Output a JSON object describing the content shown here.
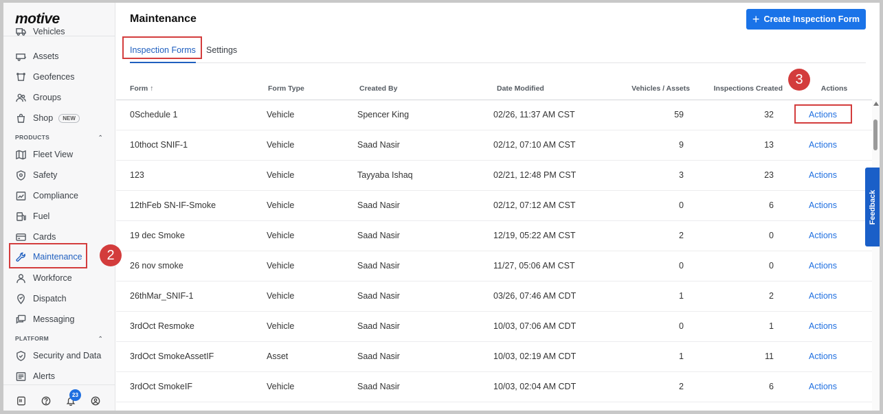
{
  "brand": {
    "logo": "motive"
  },
  "sidebar": {
    "items_top": [
      {
        "label": "Vehicles",
        "icon": "truck-icon"
      },
      {
        "label": "Assets",
        "icon": "trailer-icon"
      },
      {
        "label": "Geofences",
        "icon": "geofence-icon"
      },
      {
        "label": "Groups",
        "icon": "groups-icon"
      },
      {
        "label": "Shop",
        "icon": "shop-icon",
        "badge": "NEW"
      }
    ],
    "products_header": "PRODUCTS",
    "products": [
      {
        "label": "Fleet View",
        "icon": "map-icon"
      },
      {
        "label": "Safety",
        "icon": "shield-icon"
      },
      {
        "label": "Compliance",
        "icon": "compliance-icon"
      },
      {
        "label": "Fuel",
        "icon": "fuel-icon"
      },
      {
        "label": "Cards",
        "icon": "card-icon"
      },
      {
        "label": "Maintenance",
        "icon": "wrench-icon",
        "active": true
      },
      {
        "label": "Workforce",
        "icon": "person-icon"
      },
      {
        "label": "Dispatch",
        "icon": "dispatch-icon"
      },
      {
        "label": "Messaging",
        "icon": "messaging-icon"
      }
    ],
    "platform_header": "PLATFORM",
    "platform": [
      {
        "label": "Security and Data",
        "icon": "security-icon"
      },
      {
        "label": "Alerts",
        "icon": "alerts-icon"
      }
    ],
    "notification_count": "23"
  },
  "header": {
    "title": "Maintenance",
    "create_button": "Create Inspection Form"
  },
  "tabs": [
    {
      "label": "Inspection Forms",
      "active": true
    },
    {
      "label": "Settings",
      "active": false
    }
  ],
  "table": {
    "columns": [
      "Form ↑",
      "Form Type",
      "Created By",
      "Date Modified",
      "Vehicles / Assets",
      "Inspections Created",
      "Actions"
    ],
    "rows": [
      {
        "form": "0Schedule 1",
        "type": "Vehicle",
        "created_by": "Spencer King",
        "modified": "02/26, 11:37 AM CST",
        "vehicles": "59",
        "inspections": "32",
        "action": "Actions"
      },
      {
        "form": "10thoct SNIF-1",
        "type": "Vehicle",
        "created_by": "Saad Nasir",
        "modified": "02/12, 07:10 AM CST",
        "vehicles": "9",
        "inspections": "13",
        "action": "Actions"
      },
      {
        "form": "123",
        "type": "Vehicle",
        "created_by": "Tayyaba Ishaq",
        "modified": "02/21, 12:48 PM CST",
        "vehicles": "3",
        "inspections": "23",
        "action": "Actions"
      },
      {
        "form": "12thFeb SN-IF-Smoke",
        "type": "Vehicle",
        "created_by": "Saad Nasir",
        "modified": "02/12, 07:12 AM CST",
        "vehicles": "0",
        "inspections": "6",
        "action": "Actions"
      },
      {
        "form": "19 dec Smoke",
        "type": "Vehicle",
        "created_by": "Saad Nasir",
        "modified": "12/19, 05:22 AM CST",
        "vehicles": "2",
        "inspections": "0",
        "action": "Actions"
      },
      {
        "form": "26 nov smoke",
        "type": "Vehicle",
        "created_by": "Saad Nasir",
        "modified": "11/27, 05:06 AM CST",
        "vehicles": "0",
        "inspections": "0",
        "action": "Actions"
      },
      {
        "form": "26thMar_SNIF-1",
        "type": "Vehicle",
        "created_by": "Saad Nasir",
        "modified": "03/26, 07:46 AM CDT",
        "vehicles": "1",
        "inspections": "2",
        "action": "Actions"
      },
      {
        "form": "3rdOct Resmoke",
        "type": "Vehicle",
        "created_by": "Saad Nasir",
        "modified": "10/03, 07:06 AM CDT",
        "vehicles": "0",
        "inspections": "1",
        "action": "Actions"
      },
      {
        "form": "3rdOct SmokeAssetIF",
        "type": "Asset",
        "created_by": "Saad Nasir",
        "modified": "10/03, 02:19 AM CDT",
        "vehicles": "1",
        "inspections": "11",
        "action": "Actions"
      },
      {
        "form": "3rdOct SmokeIF",
        "type": "Vehicle",
        "created_by": "Saad Nasir",
        "modified": "10/03, 02:04 AM CDT",
        "vehicles": "2",
        "inspections": "6",
        "action": "Actions"
      }
    ]
  },
  "annotations": {
    "marker_2": "2",
    "marker_3": "3"
  },
  "feedback": "Feedback",
  "colors": {
    "accent": "#1a73e8",
    "annotation": "#d33c3c",
    "link": "#1f6fe0"
  }
}
